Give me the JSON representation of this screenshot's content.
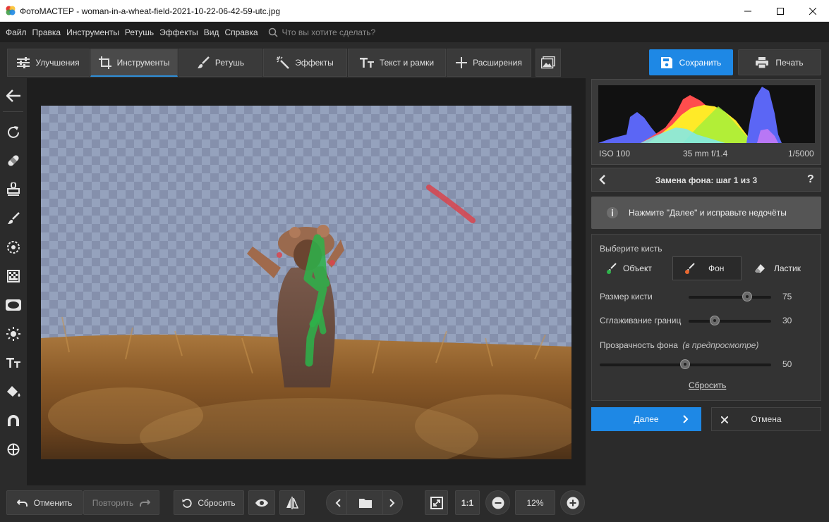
{
  "window": {
    "app_name": "ФотоМАСТЕР",
    "title": "ФотоМАСТЕР - woman-in-a-wheat-field-2021-10-22-06-42-59-utc.jpg"
  },
  "menu": {
    "items": [
      "Файл",
      "Правка",
      "Инструменты",
      "Ретушь",
      "Эффекты",
      "Вид",
      "Справка"
    ],
    "search_placeholder": "Что вы хотите сделать?"
  },
  "tabs": [
    {
      "label": "Улучшения",
      "icon": "sliders-icon",
      "active": false
    },
    {
      "label": "Инструменты",
      "icon": "crop-icon",
      "active": true
    },
    {
      "label": "Ретушь",
      "icon": "brush-icon",
      "active": false
    },
    {
      "label": "Эффекты",
      "icon": "magic-wand-icon",
      "active": false
    },
    {
      "label": "Текст и рамки",
      "icon": "text-icon",
      "active": false
    },
    {
      "label": "Расширения",
      "icon": "plus-icon",
      "active": false
    }
  ],
  "toolbar": {
    "save_label": "Сохранить",
    "print_label": "Печать"
  },
  "histogram": {
    "iso": "ISO 100",
    "lens": "35 mm f/1.4",
    "shutter": "1/5000"
  },
  "step": {
    "title": "Замена фона: шаг 1 из 3",
    "help": "?",
    "hint": "Нажмите \"Далее\" и исправьте недочёты"
  },
  "brush": {
    "section_label": "Выберите кисть",
    "object_label": "Объект",
    "background_label": "Фон",
    "eraser_label": "Ластик",
    "selected": "Фон",
    "size_label": "Размер кисти",
    "size_value": "75",
    "smooth_label": "Сглаживание границ",
    "smooth_value": "30",
    "opacity_label": "Прозрачность фона",
    "opacity_note": "(в предпросмотре)",
    "opacity_value": "50",
    "reset_link": "Сбросить"
  },
  "actions": {
    "next_label": "Далее",
    "cancel_label": "Отмена"
  },
  "bottom": {
    "undo_label": "Отменить",
    "redo_label": "Повторить",
    "reset_label": "Сбросить",
    "zoom_1to1": "1:1",
    "zoom_value": "12%"
  },
  "colors": {
    "accent": "#1e88e5",
    "object_brush": "#2db34a",
    "background_brush": "#e0534a"
  }
}
